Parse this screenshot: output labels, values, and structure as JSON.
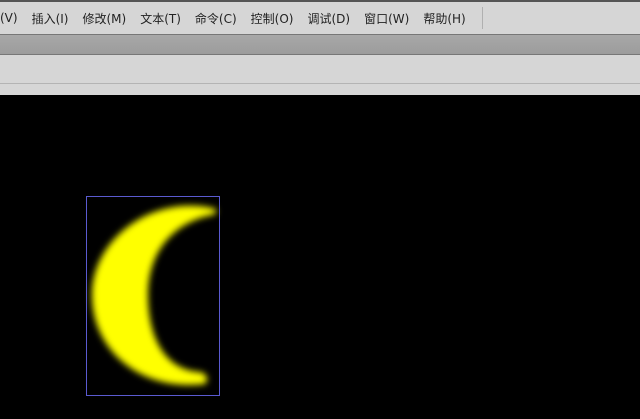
{
  "menu": {
    "items": [
      "(V)",
      "插入(I)",
      "修改(M)",
      "文本(T)",
      "命令(C)",
      "控制(O)",
      "调试(D)",
      "窗口(W)",
      "帮助(H)"
    ]
  },
  "stage": {
    "shape": "crescent-moon",
    "fill": "#ffff00",
    "selection_color": "#5a5ad0"
  }
}
